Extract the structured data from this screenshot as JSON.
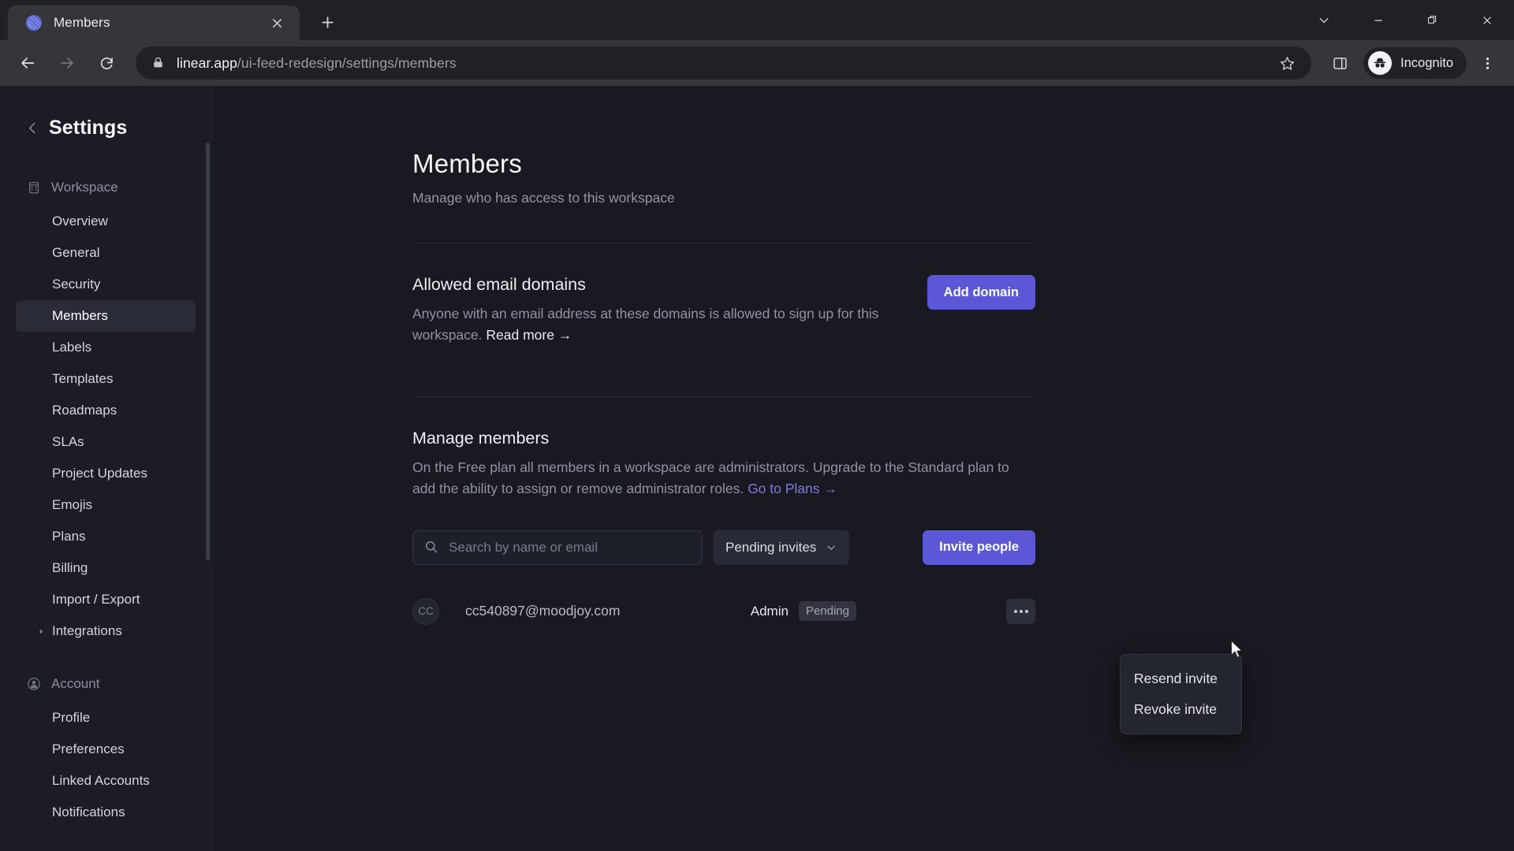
{
  "browser": {
    "tab": {
      "title": "Members",
      "favicon": "linear-logo-icon",
      "close": "close-icon"
    },
    "new_tab": "new-tab-icon",
    "window_controls": [
      "tab-search-icon",
      "minimize-icon",
      "restore-icon",
      "close-window-icon"
    ],
    "nav": {
      "back": "back-arrow-icon",
      "forward": "forward-arrow-icon",
      "reload": "reload-icon"
    },
    "omnibox": {
      "lock": "lock-icon",
      "url_host": "linear.app",
      "url_path": "/ui-feed-redesign/settings/members",
      "bookmark": "star-icon"
    },
    "side_panel": "side-panel-icon",
    "profile": {
      "label": "Incognito",
      "icon": "incognito-icon"
    },
    "menu": "three-dot-menu-icon"
  },
  "sidebar": {
    "back": "chevron-left-icon",
    "title": "Settings",
    "sections": [
      {
        "label": "Workspace",
        "icon": "building-icon",
        "items": [
          {
            "label": "Overview",
            "active": false
          },
          {
            "label": "General",
            "active": false
          },
          {
            "label": "Security",
            "active": false
          },
          {
            "label": "Members",
            "active": true
          },
          {
            "label": "Labels",
            "active": false
          },
          {
            "label": "Templates",
            "active": false
          },
          {
            "label": "Roadmaps",
            "active": false
          },
          {
            "label": "SLAs",
            "active": false
          },
          {
            "label": "Project Updates",
            "active": false
          },
          {
            "label": "Emojis",
            "active": false
          },
          {
            "label": "Plans",
            "active": false
          },
          {
            "label": "Billing",
            "active": false
          },
          {
            "label": "Import / Export",
            "active": false
          },
          {
            "label": "Integrations",
            "active": false,
            "caret": "caret-right-icon"
          }
        ]
      },
      {
        "label": "Account",
        "icon": "person-circle-icon",
        "items": [
          {
            "label": "Profile",
            "active": false
          },
          {
            "label": "Preferences",
            "active": false
          },
          {
            "label": "Linked Accounts",
            "active": false
          },
          {
            "label": "Notifications",
            "active": false
          }
        ]
      }
    ]
  },
  "main": {
    "title": "Members",
    "subtitle": "Manage who has access to this workspace",
    "allowed_domains": {
      "title": "Allowed email domains",
      "description": "Anyone with an email address at these domains is allowed to sign up for this workspace. ",
      "link": "Read more →",
      "button": "Add domain"
    },
    "manage_members": {
      "title": "Manage members",
      "description": "On the Free plan all members in a workspace are administrators. Upgrade to the Standard plan to add the ability to assign or remove administrator roles. ",
      "link": "Go to Plans →",
      "search_placeholder": "Search by name or email",
      "search_value": "",
      "filter_label": "Pending invites",
      "invite_button": "Invite people",
      "members": [
        {
          "initials": "CC",
          "email": "cc540897@moodjoy.com",
          "role": "Admin",
          "status": "Pending"
        }
      ]
    }
  },
  "context_menu": {
    "items": [
      {
        "label": "Resend invite"
      },
      {
        "label": "Revoke invite"
      }
    ]
  },
  "colors": {
    "accent": "#5b57d6",
    "link_purple": "#7f7ae0",
    "sidebar_bg": "#1b1c24",
    "page_bg": "#191a21"
  }
}
